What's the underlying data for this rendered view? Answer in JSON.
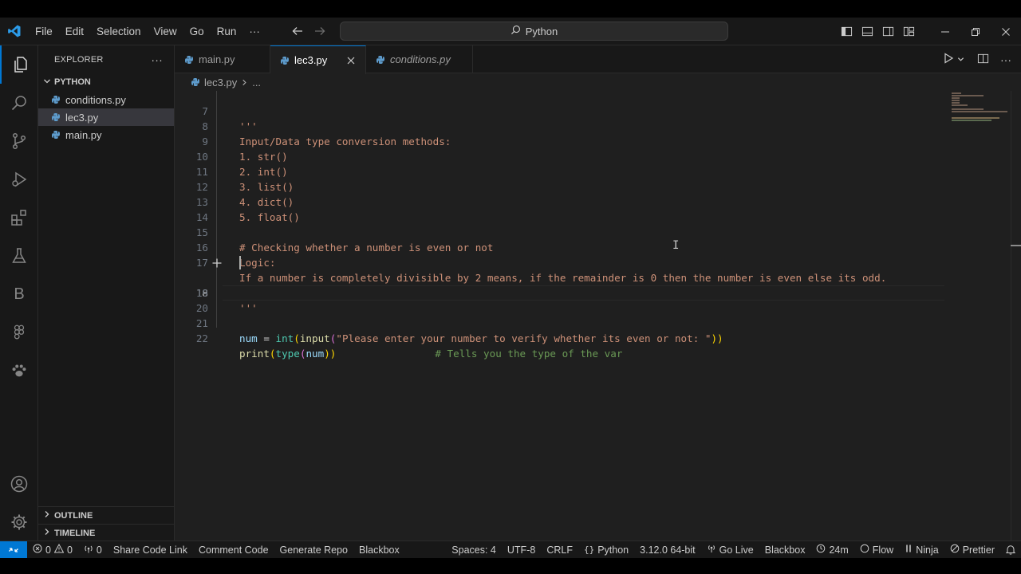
{
  "menu": {
    "items": [
      "File",
      "Edit",
      "Selection",
      "View",
      "Go",
      "Run",
      "···"
    ]
  },
  "command_center": {
    "text": "Python"
  },
  "explorer": {
    "title": "EXPLORER",
    "more": "···",
    "folder": "PYTHON",
    "files": [
      "conditions.py",
      "lec3.py",
      "main.py"
    ],
    "outline": "OUTLINE",
    "timeline": "TIMELINE"
  },
  "tabs": [
    {
      "label": "main.py"
    },
    {
      "label": "lec3.py"
    },
    {
      "label": "conditions.py"
    }
  ],
  "breadcrumb": {
    "file": "lec3.py",
    "rest": "..."
  },
  "editor": {
    "line_numbers": [
      "7",
      "8",
      "9",
      "10",
      "11",
      "12",
      "13",
      "14",
      "15",
      "16",
      "17",
      "18",
      "19",
      "20",
      "21",
      "22"
    ],
    "lines": {
      "l7": "'''",
      "l8": "Input/Data type conversion methods:",
      "l9": "1. str()",
      "l10": "2. int()",
      "l11": "3. list()",
      "l12": "4. dict()",
      "l13": "5. float()",
      "l15": "# Checking whether a number is even or not",
      "l16": "Logic:",
      "l17": "If a number is completely divisible by 2 means, if the remainder is 0 then the number is even else its odd.",
      "l19": "'''",
      "l21_var": "num",
      "l21_eq": " = ",
      "l21_int": "int",
      "l21_p1": "(",
      "l21_input": "input",
      "l21_p2": "(",
      "l21_str": "\"Please enter your number to verify whether its even or not: \"",
      "l21_p3": "))",
      "l22_print": "print",
      "l22_p1": "(",
      "l22_type": "type",
      "l22_p2": "(",
      "l22_num": "num",
      "l22_p3": "))",
      "l22_comment": "# Tells you the type of the var"
    }
  },
  "statusbar": {
    "errors": "0",
    "warnings": "0",
    "ports": "0",
    "share": "Share Code Link",
    "comment": "Comment Code",
    "generate": "Generate Repo",
    "blackbox1": "Blackbox",
    "spaces": "Spaces: 4",
    "encoding": "UTF-8",
    "eol": "CRLF",
    "language": "Python",
    "interpreter": "3.12.0 64-bit",
    "golive": "Go Live",
    "blackbox2": "Blackbox",
    "time": "24m",
    "flow": "Flow",
    "ninja": "Ninja",
    "prettier": "Prettier"
  },
  "colors": {
    "accent": "#0078d4",
    "background": "#1f1f1f",
    "sidebar": "#181818",
    "string": "#ce9178",
    "comment": "#6a9955",
    "function": "#dcdcaa"
  }
}
